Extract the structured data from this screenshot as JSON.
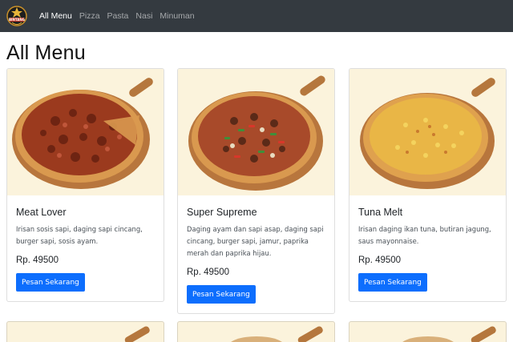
{
  "navbar": {
    "brand_logo": "bintang-pizza-logo",
    "links": [
      {
        "label": "All Menu",
        "active": true
      },
      {
        "label": "Pizza",
        "active": false
      },
      {
        "label": "Pasta",
        "active": false
      },
      {
        "label": "Nasi",
        "active": false
      },
      {
        "label": "Minuman",
        "active": false
      }
    ]
  },
  "page_title": "All Menu",
  "menu": [
    {
      "name": "Meat Lover",
      "description": "Irisan sosis sapi, daging sapi cincang, burger sapi, sosis ayam.",
      "price": "Rp. 49500",
      "button_label": "Pesan Sekarang",
      "image": "meat-lover-pizza-image"
    },
    {
      "name": "Super Supreme",
      "description": "Daging ayam dan sapi asap, daging sapi cincang, burger sapi, jamur, paprika merah dan paprika hijau.",
      "price": "Rp. 49500",
      "button_label": "Pesan Sekarang",
      "image": "super-supreme-pizza-image"
    },
    {
      "name": "Tuna Melt",
      "description": "Irisan daging ikan tuna, butiran jagung, saus mayonnaise.",
      "price": "Rp. 49500",
      "button_label": "Pesan Sekarang",
      "image": "tuna-melt-pizza-image"
    }
  ],
  "colors": {
    "navbar_bg": "#343a40",
    "button_bg": "#0d6efd",
    "image_bg": "#fbf3dc"
  }
}
